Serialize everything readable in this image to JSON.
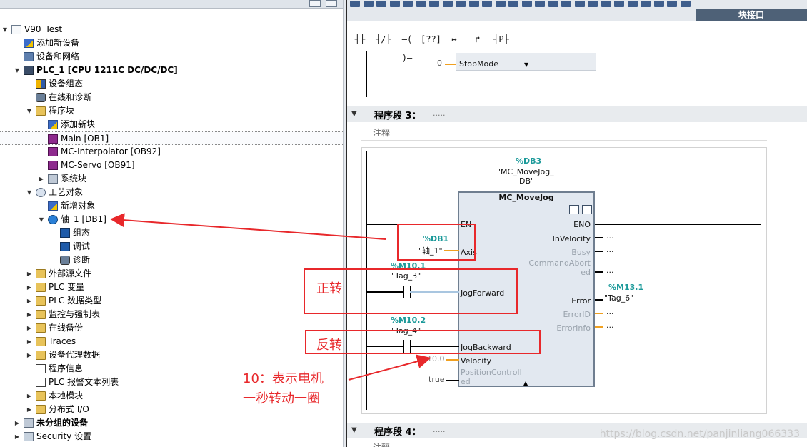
{
  "project_tree": {
    "rows": [
      {
        "label": "V90_Test",
        "indent": 0,
        "expand": "▼",
        "icon": "document-icon",
        "bold": false
      },
      {
        "label": "添加新设备",
        "indent": 1,
        "expand": "",
        "icon": "add-device-icon",
        "bold": false
      },
      {
        "label": "设备和网络",
        "indent": 1,
        "expand": "",
        "icon": "network-icon",
        "bold": false
      },
      {
        "label": "PLC_1 [CPU 1211C DC/DC/DC]",
        "indent": 1,
        "expand": "▼",
        "icon": "plc-icon",
        "bold": true
      },
      {
        "label": "设备组态",
        "indent": 2,
        "expand": "",
        "icon": "device-config-icon",
        "bold": false
      },
      {
        "label": "在线和诊断",
        "indent": 2,
        "expand": "",
        "icon": "diagnostics-icon",
        "bold": false
      },
      {
        "label": "程序块",
        "indent": 2,
        "expand": "▼",
        "icon": "folder-icon",
        "bold": false
      },
      {
        "label": "添加新块",
        "indent": 3,
        "expand": "",
        "icon": "add-block-icon",
        "bold": false
      },
      {
        "label": "Main [OB1]",
        "indent": 3,
        "expand": "",
        "icon": "ob-block-icon",
        "bold": false,
        "selected": true
      },
      {
        "label": "MC-Interpolator [OB92]",
        "indent": 3,
        "expand": "",
        "icon": "ob-block-icon",
        "bold": false
      },
      {
        "label": "MC-Servo [OB91]",
        "indent": 3,
        "expand": "",
        "icon": "ob-block-icon",
        "bold": false
      },
      {
        "label": "系统块",
        "indent": 3,
        "expand": "▶",
        "icon": "system-block-icon",
        "bold": false
      },
      {
        "label": "工艺对象",
        "indent": 2,
        "expand": "▼",
        "icon": "technology-object-icon",
        "bold": false
      },
      {
        "label": "新增对象",
        "indent": 3,
        "expand": "",
        "icon": "add-object-icon",
        "bold": false
      },
      {
        "label": "轴_1 [DB1]",
        "indent": 3,
        "expand": "▼",
        "icon": "axis-icon",
        "bold": false
      },
      {
        "label": "组态",
        "indent": 4,
        "expand": "",
        "icon": "configuration-icon",
        "bold": false
      },
      {
        "label": "调试",
        "indent": 4,
        "expand": "",
        "icon": "commissioning-icon",
        "bold": false
      },
      {
        "label": "诊断",
        "indent": 4,
        "expand": "",
        "icon": "diagnostics-icon",
        "bold": false
      },
      {
        "label": "外部源文件",
        "indent": 2,
        "expand": "▶",
        "icon": "folder-icon",
        "bold": false
      },
      {
        "label": "PLC 变量",
        "indent": 2,
        "expand": "▶",
        "icon": "folder-icon",
        "bold": false
      },
      {
        "label": "PLC 数据类型",
        "indent": 2,
        "expand": "▶",
        "icon": "folder-icon",
        "bold": false
      },
      {
        "label": "监控与强制表",
        "indent": 2,
        "expand": "▶",
        "icon": "folder-icon",
        "bold": false
      },
      {
        "label": "在线备份",
        "indent": 2,
        "expand": "▶",
        "icon": "folder-icon",
        "bold": false
      },
      {
        "label": "Traces",
        "indent": 2,
        "expand": "▶",
        "icon": "folder-icon",
        "bold": false
      },
      {
        "label": "设备代理数据",
        "indent": 2,
        "expand": "▶",
        "icon": "folder-icon",
        "bold": false
      },
      {
        "label": "程序信息",
        "indent": 2,
        "expand": "",
        "icon": "program-info-icon",
        "bold": false
      },
      {
        "label": "PLC 报警文本列表",
        "indent": 2,
        "expand": "",
        "icon": "alarm-text-icon",
        "bold": false
      },
      {
        "label": "本地模块",
        "indent": 2,
        "expand": "▶",
        "icon": "folder-icon",
        "bold": false
      },
      {
        "label": "分布式 I/O",
        "indent": 2,
        "expand": "▶",
        "icon": "folder-icon",
        "bold": false
      },
      {
        "label": "未分组的设备",
        "indent": 1,
        "expand": "▶",
        "icon": "ungrouped-devices-icon",
        "bold": true
      },
      {
        "label": "Security 设置",
        "indent": 1,
        "expand": "▶",
        "icon": "security-icon",
        "bold": false
      }
    ]
  },
  "editor": {
    "block_interface_tab": "块接口",
    "lad_buttons": [
      "┤├",
      "┤/├",
      "–( )–",
      "[??]",
      "↦",
      "↱",
      "┤P├"
    ],
    "network2": {
      "pin_value": "0",
      "pin_name": "StopMode"
    },
    "network3": {
      "title": "程序段 3：",
      "dots": ".....",
      "comment": "注释",
      "instance_db_addr": "%DB3",
      "instance_db_name_1": "\"MC_MoveJog_",
      "instance_db_name_2": "DB\"",
      "fb_title": "MC_MoveJog",
      "pins_left": {
        "en": "EN",
        "axis": "Axis",
        "jog_forward": "JogForward",
        "jog_backward": "JogBackward",
        "velocity": "Velocity",
        "position_controlled_1": "PositionControll",
        "position_controlled_2": "ed"
      },
      "pins_right": {
        "eno": "ENO",
        "in_velocity": "InVelocity",
        "busy": "Busy",
        "command_aborted_1": "CommandAbort",
        "command_aborted_2": "ed",
        "error": "Error",
        "error_id": "ErrorID",
        "error_info": "ErrorInfo"
      },
      "axis_addr": "%DB1",
      "axis_name": "\"轴_1\"",
      "contact1_addr": "%M10.1",
      "contact1_name": "\"Tag_3\"",
      "contact2_addr": "%M10.2",
      "contact2_name": "\"Tag_4\"",
      "velocity_value": "10.0",
      "position_controlled_value": "true",
      "error_addr": "%M13.1",
      "error_name": "\"Tag_6\"",
      "open_pin": "..."
    },
    "network4": {
      "title": "程序段 4：",
      "dots": ".....",
      "comment": "注释"
    }
  },
  "annotations": {
    "forward": "正转",
    "backward": "反转",
    "velocity_note_1": "10：表示电机",
    "velocity_note_2": "一秒转动一圈",
    "red_color": "#e8282b"
  },
  "watermark": "https://blog.csdn.net/panjinliang066333"
}
